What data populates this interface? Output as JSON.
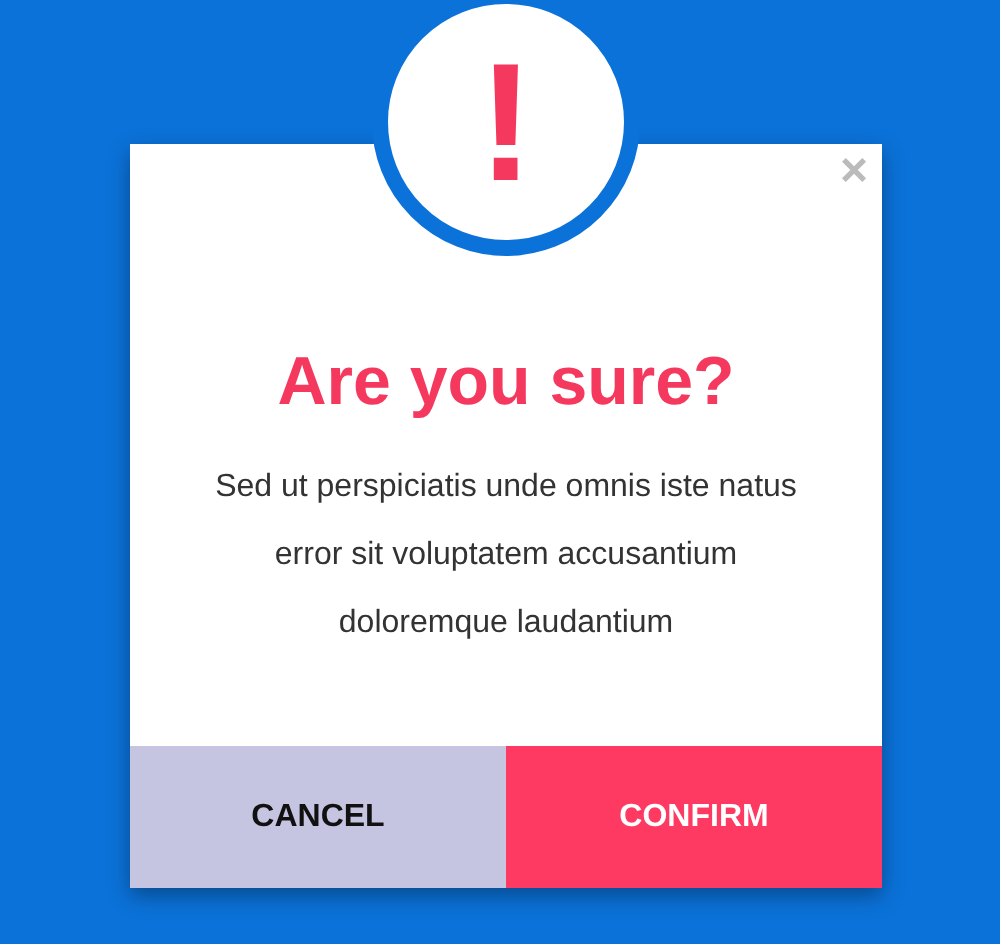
{
  "dialog": {
    "icon": "!",
    "close": "×",
    "title": "Are you sure?",
    "message": "Sed ut perspiciatis unde omnis iste natus error sit voluptatem accusantium doloremque laudantium",
    "buttons": [
      {
        "kind": "cancel",
        "label": "CANCEL"
      },
      {
        "kind": "confirm",
        "label": "CONFIRM"
      }
    ]
  }
}
